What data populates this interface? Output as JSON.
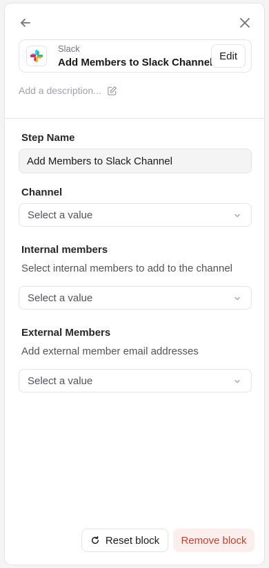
{
  "app": {
    "provider": "Slack",
    "title": "Add Members to Slack Channel",
    "edit_label": "Edit",
    "description_placeholder": "Add a description..."
  },
  "form": {
    "step_name": {
      "label": "Step Name",
      "value": "Add Members to Slack Channel"
    },
    "channel": {
      "label": "Channel",
      "placeholder": "Select a value"
    },
    "internal_members": {
      "label": "Internal members",
      "helper": "Select internal members to add to the channel",
      "placeholder": "Select a value"
    },
    "external_members": {
      "label": "External Members",
      "helper": "Add external member email addresses",
      "placeholder": "Select a value"
    }
  },
  "footer": {
    "reset_label": "Reset block",
    "remove_label": "Remove block"
  },
  "icons": {
    "back": "arrow-left-icon",
    "close": "close-icon",
    "edit_description": "pencil-square-icon",
    "reset": "rotate-icon",
    "chevron": "chevron-down-icon"
  },
  "colors": {
    "remove_bg": "#fdeeee",
    "remove_text": "#c2412d",
    "slack_blue": "#36C5F0",
    "slack_green": "#2EB67D",
    "slack_yellow": "#ECB22E",
    "slack_red": "#E01E5A"
  }
}
